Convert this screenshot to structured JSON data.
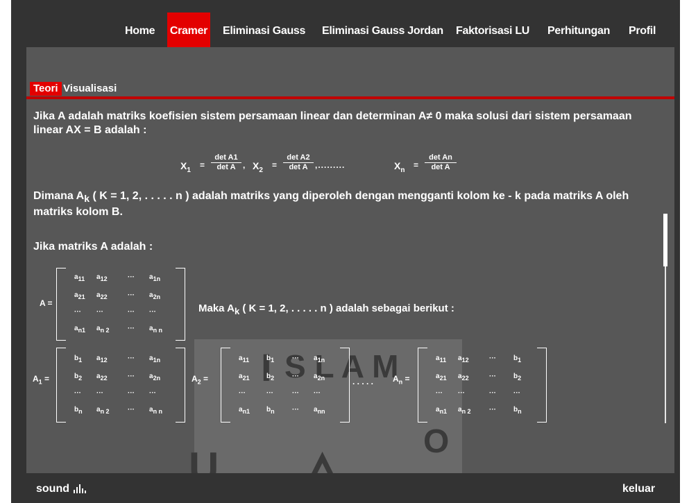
{
  "nav": [
    "Home",
    "Cramer",
    "Eliminasi Gauss",
    "Eliminasi Gauss Jordan",
    "Faktorisasi LU",
    "Perhitungan",
    "Profil"
  ],
  "subtabs": [
    "Teori",
    "Visualisasi"
  ],
  "para1": "Jika A adalah matriks koefisien sistem persamaan linear dan determinan A≠ 0 maka solusi dari sistem persamaan linear AX = B adalah :",
  "formula": {
    "x1": "X",
    "x1sub": "1",
    "eq": "=",
    "f1num": "det A1",
    "f1den": "det A",
    "x2": "X",
    "x2sub": "2",
    "f2num": "det A2",
    "f2den": "det A",
    "dots": ",.........",
    "xn": "X",
    "xnsub": "n",
    "fnnum": "det An",
    "fnden": "det A",
    "comma": ","
  },
  "para2a": "Dimana A",
  "para2sub": "k",
  "para2b": " ( K = 1, 2, . . . . . n ) adalah matriks yang diperoleh dengan mengganti kolom ke - k  pada matriks A oleh matriks kolom B.",
  "para3": "Jika matriks A adalah :",
  "maka_a": "Maka A",
  "maka_sub": "k",
  "maka_b": " ( K = 1, 2, . . . . . n ) adalah sebagai berikut :",
  "matA_label": "A =",
  "matA1_label": "A",
  "matA1_sub": "1",
  "matA2_label": "A",
  "matA2_sub": "2",
  "matAn_label": "A",
  "matAn_sub": "n",
  "between_dots": ". . . . .",
  "watermark": "ISLAM",
  "bottom": {
    "sound": "sound",
    "keluar": "keluar"
  },
  "colors": {
    "accent": "#e30000",
    "panel": "#575757",
    "frame": "#333333"
  }
}
